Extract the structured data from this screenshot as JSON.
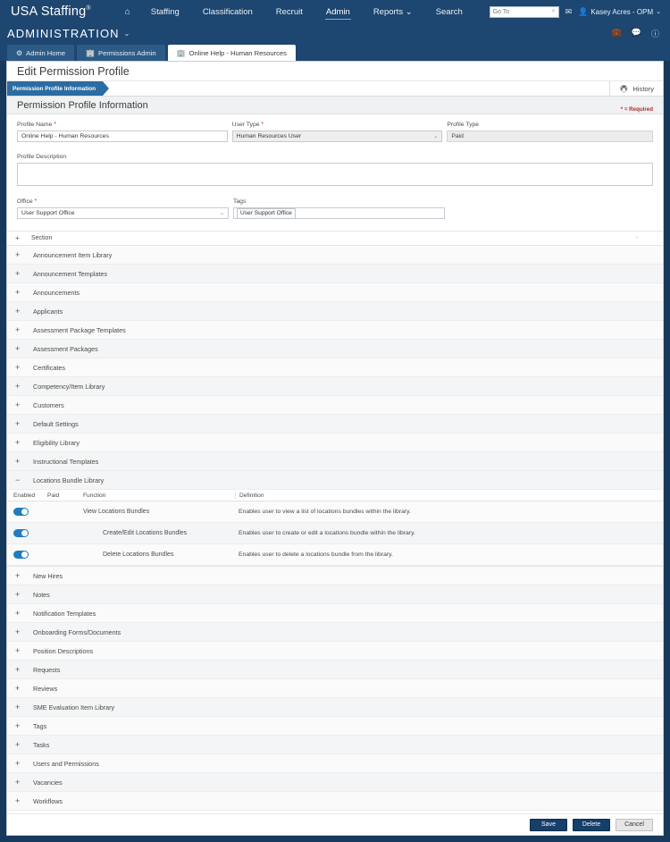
{
  "topnav": {
    "brand": "USA Staffing",
    "brand_reg": "®",
    "links": [
      {
        "label": "⌂",
        "name": "home",
        "active": false
      },
      {
        "label": "Staffing",
        "name": "staffing",
        "active": false
      },
      {
        "label": "Classification",
        "name": "classification",
        "active": false
      },
      {
        "label": "Recruit",
        "name": "recruit",
        "active": false
      },
      {
        "label": "Admin",
        "name": "admin",
        "active": true
      },
      {
        "label": "Reports ⌄",
        "name": "reports",
        "active": false
      },
      {
        "label": "Search",
        "name": "search",
        "active": false
      }
    ],
    "goto_placeholder": "Go To",
    "goto_value": "",
    "search_icon": "search-icon",
    "mail_icon": "✉",
    "user_name": "Kasey Acres - OPM",
    "user_caret": "⌄"
  },
  "adminbar": {
    "title": "ADMINISTRATION",
    "caret": "⌄",
    "icons": [
      "briefcase-icon",
      "message-icon",
      "help-icon"
    ]
  },
  "tabs": [
    {
      "label": "Admin Home",
      "icon": "gear-icon",
      "active": false
    },
    {
      "label": "Permissions Admin",
      "icon": "building-icon",
      "active": false
    },
    {
      "label": "Online Help - Human Resources",
      "icon": "building-icon",
      "active": true
    }
  ],
  "page": {
    "title": "Edit Permission Profile",
    "crumb": "Permission Profile Information",
    "history_label": "History",
    "history_icon": "printer-icon",
    "section_title": "Permission Profile Information",
    "required_note": "* = Required"
  },
  "form": {
    "profile_name": {
      "label": "Profile Name",
      "required": true,
      "value": "Online Help - Human Resources"
    },
    "user_type": {
      "label": "User Type",
      "required": true,
      "value": "Human Resources User"
    },
    "profile_type": {
      "label": "Profile Type",
      "required": false,
      "value": "Paid"
    },
    "profile_description": {
      "label": "Profile Description",
      "required": false,
      "value": ""
    },
    "office": {
      "label": "Office",
      "required": true,
      "value": "User Support Office"
    },
    "tags": {
      "label": "Tags",
      "required": false,
      "chips": [
        "User Support Office"
      ]
    }
  },
  "accordion": {
    "header_label": "Section",
    "header_plus": "+",
    "collapse_all": "-",
    "items": [
      {
        "label": "Announcement Item Library",
        "expanded": false
      },
      {
        "label": "Announcement Templates",
        "expanded": false
      },
      {
        "label": "Announcements",
        "expanded": false
      },
      {
        "label": "Applicants",
        "expanded": false
      },
      {
        "label": "Assessment Package Templates",
        "expanded": false
      },
      {
        "label": "Assessment Packages",
        "expanded": false
      },
      {
        "label": "Certificates",
        "expanded": false
      },
      {
        "label": "Competency/Item Library",
        "expanded": false
      },
      {
        "label": "Customers",
        "expanded": false
      },
      {
        "label": "Default Settings",
        "expanded": false
      },
      {
        "label": "Eligibility Library",
        "expanded": false
      },
      {
        "label": "Instructional Templates",
        "expanded": false
      }
    ],
    "expanded_section": {
      "label": "Locations Bundle Library",
      "sign": "−",
      "columns": [
        "Enabled",
        "Paid",
        "Function",
        "Definition"
      ],
      "rows": [
        {
          "enabled": true,
          "paid": "",
          "function": "View Locations Bundles",
          "definition": "Enables user to view a list of locations bundles within the library.",
          "indent": false
        },
        {
          "enabled": true,
          "paid": "",
          "function": "Create/Edit Locations Bundles",
          "definition": "Enables user to create or edit a locations bundle within the library.",
          "indent": true
        },
        {
          "enabled": true,
          "paid": "",
          "function": "Delete Locations Bundles",
          "definition": "Enables user to delete a locations bundle from the library.",
          "indent": true
        }
      ]
    },
    "items_after": [
      {
        "label": "New Hires",
        "expanded": false
      },
      {
        "label": "Notes",
        "expanded": false
      },
      {
        "label": "Notification Templates",
        "expanded": false
      },
      {
        "label": "Onboarding Forms/Documents",
        "expanded": false
      },
      {
        "label": "Position Descriptions",
        "expanded": false
      },
      {
        "label": "Requests",
        "expanded": false
      },
      {
        "label": "Reviews",
        "expanded": false
      },
      {
        "label": "SME Evaluation Item Library",
        "expanded": false
      },
      {
        "label": "Tags",
        "expanded": false
      },
      {
        "label": "Tasks",
        "expanded": false
      },
      {
        "label": "Users and Permissions",
        "expanded": false
      },
      {
        "label": "Vacancies",
        "expanded": false
      },
      {
        "label": "Workflows",
        "expanded": false
      }
    ]
  },
  "footer": {
    "save": "Save",
    "delete": "Delete",
    "cancel": "Cancel"
  },
  "colors": {
    "nav_blue": "#1d4670",
    "frame_blue": "#16395c",
    "crumb_blue": "#2b6ca3",
    "toggle_blue": "#1f7cbf",
    "required_red": "#b02a2a",
    "button_navy": "#163f69"
  }
}
